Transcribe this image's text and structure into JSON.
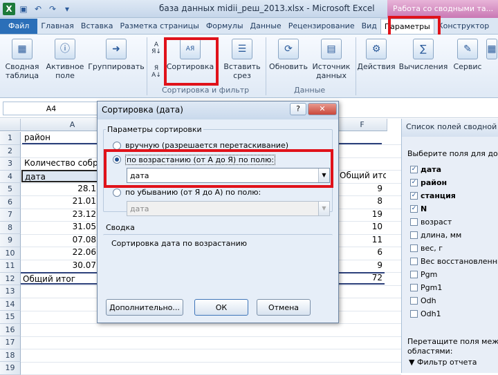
{
  "window": {
    "title": "база данных midii_реш_2013.xlsx  -  Microsoft Excel",
    "context_tab_title": "Работа со сводными та..."
  },
  "ribbon_tabs": [
    "Файл",
    "Главная",
    "Вставка",
    "Разметка страницы",
    "Формулы",
    "Данные",
    "Рецензирование",
    "Вид",
    "Параметры",
    "Конструктор"
  ],
  "ribbon": {
    "summary_table": "Сводная таблица",
    "active_field": "Активное поле",
    "group": "Группировать",
    "sort_az": "А Я",
    "sort_za": "Я А",
    "sort": "Сортировка",
    "insert_slicer": "Вставить срез",
    "refresh": "Обновить",
    "data_source": "Источник данных",
    "actions": "Действия",
    "calculations": "Вычисления",
    "service": "Сервис",
    "group_sort_filter": "Сортировка и фильтр",
    "group_data": "Данные"
  },
  "formula_bar": {
    "name_box": "A4"
  },
  "grid": {
    "columns": [
      "A",
      "F"
    ],
    "rows": [
      "1",
      "2",
      "3",
      "4",
      "5",
      "6",
      "7",
      "8",
      "9",
      "10",
      "11",
      "12",
      "13",
      "14",
      "15",
      "16",
      "17",
      "18",
      "19"
    ],
    "cells": {
      "a1": "район",
      "a3": "Количество собра",
      "a4": "дата",
      "a5": "28.1",
      "a6": "21.01",
      "a7": "23.12",
      "a8": "31.05",
      "a9": "07.08",
      "a10": "22.06",
      "a11": "30.07",
      "a12": "Общий итог",
      "f4": "Общий итог",
      "f5": "9",
      "f6": "8",
      "f7": "19",
      "f8": "10",
      "f9": "11",
      "f10": "6",
      "f11": "9",
      "f12": "72"
    }
  },
  "pane": {
    "title": "Список полей сводной",
    "choose": "Выберите поля для доба",
    "fields": [
      {
        "label": "дата",
        "checked": true
      },
      {
        "label": "район",
        "checked": true
      },
      {
        "label": "станция",
        "checked": true
      },
      {
        "label": "N",
        "checked": true
      },
      {
        "label": "возраст",
        "checked": false
      },
      {
        "label": "длина, мм",
        "checked": false
      },
      {
        "label": "вес, г",
        "checked": false
      },
      {
        "label": "Вес восстановленны",
        "checked": false
      },
      {
        "label": "Pgm",
        "checked": false
      },
      {
        "label": "Pgm1",
        "checked": false
      },
      {
        "label": "Odh",
        "checked": false
      },
      {
        "label": "Odh1",
        "checked": false
      }
    ],
    "drag_hint_1": "Перетащите поля межд",
    "drag_hint_2": "областями:",
    "report_filter": "Фильтр отчета"
  },
  "dialog": {
    "title": "Сортировка (дата)",
    "help": "?",
    "close": "✕",
    "sort_params": "Параметры сортировки",
    "manual": "вручную (разрешается перетаскивание)",
    "ascending": "по возрастанию (от А до Я) по полю:",
    "ascending_field": "дата",
    "descending": "по убыванию (от Я до А) по полю:",
    "descending_field": "дата",
    "summary_label": "Сводка",
    "summary_text": "Сортировка дата по возрастанию",
    "more_button": "Дополнительно...",
    "ok_button": "ОК",
    "cancel_button": "Отмена",
    "selected": "ascending"
  },
  "colors": {
    "highlight": "#e0121a",
    "accent": "#2b6fb8"
  }
}
